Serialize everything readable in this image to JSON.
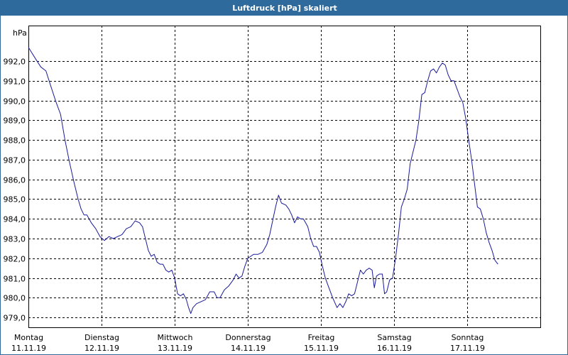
{
  "chart_data": {
    "type": "line",
    "title": "Luftdruck [hPa] skaliert",
    "ylabel": "hPa",
    "xlabel": "",
    "ylim": [
      978.5,
      993.8
    ],
    "xlim": [
      0,
      7.0
    ],
    "grid": true,
    "y_ticks": [
      {
        "value": 979.0,
        "label": "979,0"
      },
      {
        "value": 980.0,
        "label": "980,0"
      },
      {
        "value": 981.0,
        "label": "981,0"
      },
      {
        "value": 982.0,
        "label": "982,0"
      },
      {
        "value": 983.0,
        "label": "983,0"
      },
      {
        "value": 984.0,
        "label": "984,0"
      },
      {
        "value": 985.0,
        "label": "985,0"
      },
      {
        "value": 986.0,
        "label": "986,0"
      },
      {
        "value": 987.0,
        "label": "987,0"
      },
      {
        "value": 988.0,
        "label": "988,0"
      },
      {
        "value": 989.0,
        "label": "989,0"
      },
      {
        "value": 990.0,
        "label": "990,0"
      },
      {
        "value": 991.0,
        "label": "991,0"
      },
      {
        "value": 992.0,
        "label": "992,0"
      }
    ],
    "x_ticks": [
      {
        "value": 0,
        "day": "Montag",
        "date": "11.11.19"
      },
      {
        "value": 1,
        "day": "Dienstag",
        "date": "12.11.19"
      },
      {
        "value": 2,
        "day": "Mittwoch",
        "date": "13.11.19"
      },
      {
        "value": 3,
        "day": "Donnerstag",
        "date": "14.11.19"
      },
      {
        "value": 4,
        "day": "Freitag",
        "date": "15.11.19"
      },
      {
        "value": 5,
        "day": "Samstag",
        "date": "16.11.19"
      },
      {
        "value": 6,
        "day": "Sonntag",
        "date": "17.11.19"
      }
    ],
    "series": [
      {
        "color": "#1a1a9c",
        "points": [
          [
            0.0,
            992.7
          ],
          [
            0.1,
            992.1
          ],
          [
            0.17,
            991.7
          ],
          [
            0.24,
            991.5
          ],
          [
            0.3,
            990.8
          ],
          [
            0.38,
            989.9
          ],
          [
            0.44,
            989.3
          ],
          [
            0.5,
            988.0
          ],
          [
            0.56,
            986.9
          ],
          [
            0.62,
            985.9
          ],
          [
            0.68,
            985.0
          ],
          [
            0.72,
            984.5
          ],
          [
            0.76,
            984.2
          ],
          [
            0.8,
            984.2
          ],
          [
            0.86,
            983.8
          ],
          [
            0.92,
            983.5
          ],
          [
            0.98,
            983.1
          ],
          [
            1.04,
            982.9
          ],
          [
            1.1,
            983.1
          ],
          [
            1.16,
            983.0
          ],
          [
            1.22,
            983.1
          ],
          [
            1.28,
            983.2
          ],
          [
            1.34,
            983.5
          ],
          [
            1.4,
            983.6
          ],
          [
            1.46,
            983.9
          ],
          [
            1.52,
            983.8
          ],
          [
            1.56,
            983.6
          ],
          [
            1.6,
            983.0
          ],
          [
            1.64,
            982.4
          ],
          [
            1.68,
            982.1
          ],
          [
            1.72,
            982.2
          ],
          [
            1.76,
            981.8
          ],
          [
            1.8,
            981.7
          ],
          [
            1.84,
            981.7
          ],
          [
            1.88,
            981.4
          ],
          [
            1.92,
            981.3
          ],
          [
            1.96,
            981.4
          ],
          [
            2.0,
            981.0
          ],
          [
            2.04,
            980.2
          ],
          [
            2.08,
            980.1
          ],
          [
            2.12,
            980.2
          ],
          [
            2.16,
            979.9
          ],
          [
            2.19,
            979.5
          ],
          [
            2.22,
            979.2
          ],
          [
            2.25,
            979.5
          ],
          [
            2.3,
            979.7
          ],
          [
            2.36,
            979.8
          ],
          [
            2.42,
            979.9
          ],
          [
            2.48,
            980.3
          ],
          [
            2.54,
            980.3
          ],
          [
            2.58,
            980.0
          ],
          [
            2.62,
            980.0
          ],
          [
            2.68,
            980.4
          ],
          [
            2.74,
            980.6
          ],
          [
            2.8,
            980.9
          ],
          [
            2.84,
            981.2
          ],
          [
            2.88,
            981.0
          ],
          [
            2.92,
            981.1
          ],
          [
            2.96,
            981.6
          ],
          [
            3.0,
            982.0
          ],
          [
            3.04,
            982.1
          ],
          [
            3.08,
            982.2
          ],
          [
            3.14,
            982.2
          ],
          [
            3.2,
            982.3
          ],
          [
            3.26,
            982.7
          ],
          [
            3.3,
            983.2
          ],
          [
            3.34,
            983.9
          ],
          [
            3.38,
            984.6
          ],
          [
            3.42,
            985.2
          ],
          [
            3.46,
            984.8
          ],
          [
            3.52,
            984.7
          ],
          [
            3.56,
            984.5
          ],
          [
            3.6,
            984.2
          ],
          [
            3.64,
            983.8
          ],
          [
            3.68,
            984.1
          ],
          [
            3.72,
            984.0
          ],
          [
            3.76,
            984.0
          ],
          [
            3.82,
            983.6
          ],
          [
            3.86,
            983.0
          ],
          [
            3.9,
            982.6
          ],
          [
            3.94,
            982.6
          ],
          [
            3.98,
            982.3
          ],
          [
            4.02,
            981.6
          ],
          [
            4.06,
            981.0
          ],
          [
            4.1,
            980.6
          ],
          [
            4.16,
            980.0
          ],
          [
            4.22,
            979.5
          ],
          [
            4.26,
            979.7
          ],
          [
            4.3,
            979.5
          ],
          [
            4.34,
            979.8
          ],
          [
            4.38,
            980.2
          ],
          [
            4.42,
            980.1
          ],
          [
            4.46,
            980.2
          ],
          [
            4.5,
            980.8
          ],
          [
            4.54,
            981.4
          ],
          [
            4.58,
            981.2
          ],
          [
            4.62,
            981.4
          ],
          [
            4.66,
            981.5
          ],
          [
            4.7,
            981.4
          ],
          [
            4.73,
            980.5
          ],
          [
            4.76,
            981.1
          ],
          [
            4.8,
            981.2
          ],
          [
            4.84,
            981.2
          ],
          [
            4.87,
            980.2
          ],
          [
            4.9,
            980.3
          ],
          [
            4.94,
            980.9
          ],
          [
            4.98,
            981.0
          ],
          [
            5.02,
            982.0
          ],
          [
            5.06,
            983.2
          ],
          [
            5.1,
            984.6
          ],
          [
            5.14,
            985.0
          ],
          [
            5.18,
            985.5
          ],
          [
            5.22,
            986.8
          ],
          [
            5.26,
            987.4
          ],
          [
            5.3,
            988.0
          ],
          [
            5.34,
            989.0
          ],
          [
            5.38,
            990.3
          ],
          [
            5.42,
            990.4
          ],
          [
            5.46,
            991.0
          ],
          [
            5.5,
            991.5
          ],
          [
            5.54,
            991.6
          ],
          [
            5.58,
            991.4
          ],
          [
            5.62,
            991.7
          ],
          [
            5.66,
            991.9
          ],
          [
            5.7,
            991.8
          ],
          [
            5.74,
            991.3
          ],
          [
            5.78,
            991.0
          ],
          [
            5.82,
            991.0
          ],
          [
            5.86,
            990.6
          ],
          [
            5.9,
            990.2
          ],
          [
            5.94,
            989.9
          ],
          [
            5.98,
            989.1
          ],
          [
            6.02,
            988.0
          ],
          [
            6.06,
            987.0
          ],
          [
            6.1,
            985.8
          ],
          [
            6.14,
            984.6
          ],
          [
            6.18,
            984.5
          ],
          [
            6.22,
            984.0
          ],
          [
            6.26,
            983.3
          ],
          [
            6.3,
            982.8
          ],
          [
            6.34,
            982.4
          ],
          [
            6.38,
            981.9
          ],
          [
            6.42,
            981.7
          ]
        ]
      }
    ]
  }
}
